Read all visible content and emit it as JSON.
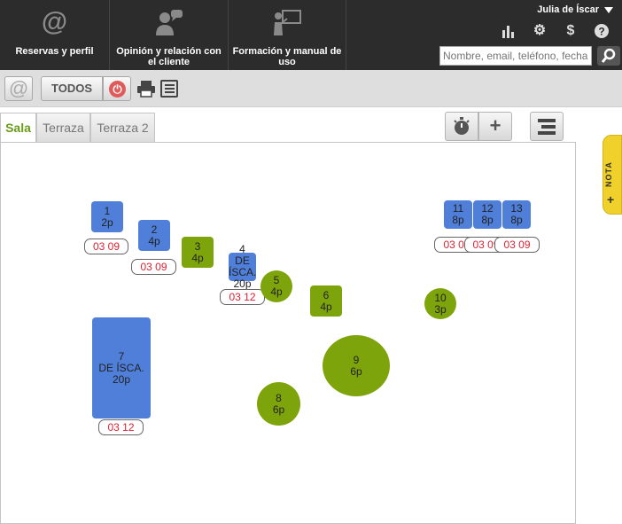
{
  "nav": {
    "items": [
      {
        "label": "Reservas y perfil",
        "icon": "at-icon"
      },
      {
        "label": "Opinión y relación con el cliente",
        "icon": "person-speech-icon"
      },
      {
        "label": "Formación y manual de uso",
        "icon": "teacher-board-icon"
      }
    ]
  },
  "user": {
    "name": "Julia de Íscar"
  },
  "top_icons": [
    "bar-chart-icon",
    "gear-icon",
    "dollar-icon",
    "help-icon"
  ],
  "search": {
    "placeholder": "Nombre, email, teléfono, fecha"
  },
  "toolbar": {
    "todos_label": "TODOS"
  },
  "tabs": [
    {
      "label": "Sala",
      "active": true
    },
    {
      "label": "Terraza",
      "active": false
    },
    {
      "label": "Terraza 2",
      "active": false
    }
  ],
  "nota": {
    "label": "NOTA",
    "plus": "+"
  },
  "colors": {
    "blue_table": "#4f7fd9",
    "green_table": "#7ea40b",
    "active_tab": "#6a9a1a",
    "reservation_text": "#d23"
  },
  "tables": [
    {
      "number": "1",
      "name": "",
      "capacity": "2p",
      "color": "blue",
      "reservation": "03 09"
    },
    {
      "number": "2",
      "name": "",
      "capacity": "4p",
      "color": "blue",
      "reservation": "03 09"
    },
    {
      "number": "3",
      "name": "",
      "capacity": "4p",
      "color": "green",
      "reservation": ""
    },
    {
      "number": "4",
      "name": "DE ÍSCA.",
      "capacity": "20p",
      "color": "blue",
      "reservation": "03 12"
    },
    {
      "number": "5",
      "name": "",
      "capacity": "4p",
      "color": "green",
      "reservation": ""
    },
    {
      "number": "6",
      "name": "",
      "capacity": "4p",
      "color": "green",
      "reservation": ""
    },
    {
      "number": "7",
      "name": "DE ÍSCA.",
      "capacity": "20p",
      "color": "blue",
      "reservation": "03 12"
    },
    {
      "number": "8",
      "name": "",
      "capacity": "6p",
      "color": "green",
      "reservation": ""
    },
    {
      "number": "9",
      "name": "",
      "capacity": "6p",
      "color": "green",
      "reservation": ""
    },
    {
      "number": "10",
      "name": "",
      "capacity": "3p",
      "color": "green",
      "reservation": ""
    },
    {
      "number": "11",
      "name": "",
      "capacity": "8p",
      "color": "blue",
      "reservation": "03 09"
    },
    {
      "number": "12",
      "name": "",
      "capacity": "8p",
      "color": "blue",
      "reservation": "03 09"
    },
    {
      "number": "13",
      "name": "",
      "capacity": "8p",
      "color": "blue",
      "reservation": "03 09"
    }
  ]
}
